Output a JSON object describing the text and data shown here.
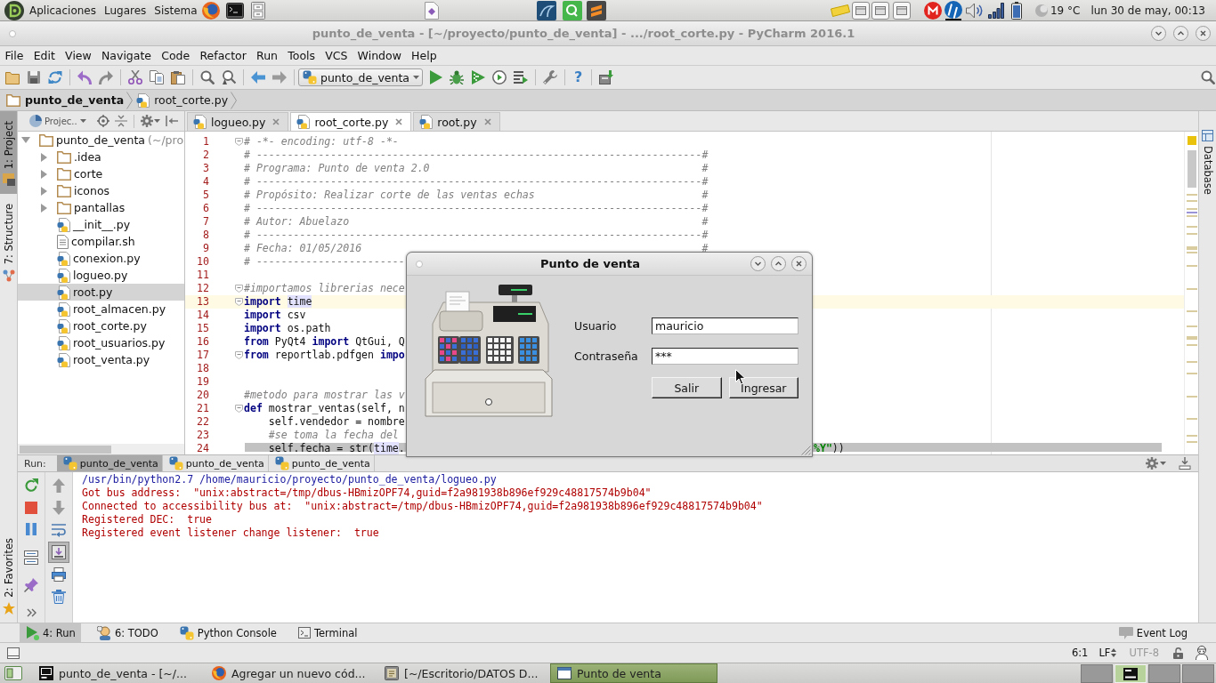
{
  "top_panel": {
    "menus": [
      "Aplicaciones",
      "Lugares",
      "Sistema"
    ],
    "temperature": "19 °C",
    "clock": "lun 30 de may, 00:13"
  },
  "window": {
    "title": "punto_de_venta - [~/proyecto/punto_de_venta] - .../root_corte.py - PyCharm 2016.1"
  },
  "menu_bar": [
    "File",
    "Edit",
    "View",
    "Navigate",
    "Code",
    "Refactor",
    "Run",
    "Tools",
    "VCS",
    "Window",
    "Help"
  ],
  "toolbar": {
    "run_configuration": "punto_de_venta",
    "help": "?"
  },
  "navigation_bar": [
    {
      "kind": "folder",
      "label": "punto_de_venta"
    },
    {
      "kind": "python",
      "label": "root_corte.py"
    }
  ],
  "left_tool_tabs": {
    "top": [
      {
        "kind": "project",
        "label": "1: Project",
        "selected": true
      },
      {
        "kind": "structure",
        "label": "7: Structure",
        "selected": false
      }
    ],
    "bottom": [
      {
        "kind": "favorites",
        "label": "2: Favorites",
        "selected": false
      }
    ]
  },
  "right_tool_tabs": [
    {
      "label": "Database",
      "selected": false
    }
  ],
  "project": {
    "view": "Projec..",
    "tree": [
      {
        "kind": "folder",
        "label": "punto_de_venta",
        "path": "(~/pro",
        "expanded": true,
        "selected": false,
        "children": [
          {
            "kind": "folder",
            "label": ".idea",
            "expanded": false,
            "selected": false
          },
          {
            "kind": "folder",
            "label": "corte",
            "expanded": false,
            "selected": false
          },
          {
            "kind": "folder",
            "label": "iconos",
            "expanded": false,
            "selected": false
          },
          {
            "kind": "folder",
            "label": "pantallas",
            "expanded": false,
            "selected": false
          },
          {
            "kind": "python",
            "label": "__init__.py",
            "selected": false
          },
          {
            "kind": "text",
            "label": "compilar.sh",
            "selected": false
          },
          {
            "kind": "python",
            "label": "conexion.py",
            "selected": false
          },
          {
            "kind": "python",
            "label": "logueo.py",
            "selected": false
          },
          {
            "kind": "python",
            "label": "root.py",
            "selected": true
          },
          {
            "kind": "python",
            "label": "root_almacen.py",
            "selected": false
          },
          {
            "kind": "python",
            "label": "root_corte.py",
            "selected": false
          },
          {
            "kind": "python",
            "label": "root_usuarios.py",
            "selected": false
          },
          {
            "kind": "python",
            "label": "root_venta.py",
            "selected": false
          }
        ]
      }
    ]
  },
  "editor": {
    "tabs": [
      {
        "label": "logueo.py",
        "selected": false
      },
      {
        "label": "root_corte.py",
        "selected": true
      },
      {
        "label": "root.py",
        "selected": false
      }
    ],
    "lines": [
      {
        "number": "1",
        "fold": true,
        "current": false,
        "parts": [
          {
            "kind": "comment",
            "text": "# -*- encoding: utf-8 -*-"
          }
        ]
      },
      {
        "number": "2",
        "fold": false,
        "current": false,
        "parts": [
          {
            "kind": "comment",
            "text": "# ------------------------------------------------------------------------#"
          }
        ]
      },
      {
        "number": "3",
        "fold": false,
        "current": false,
        "parts": [
          {
            "kind": "comment",
            "text": "# Programa: Punto de venta 2.0                                            #"
          }
        ]
      },
      {
        "number": "4",
        "fold": false,
        "current": false,
        "parts": [
          {
            "kind": "comment",
            "text": "# ------------------------------------------------------------------------#"
          }
        ]
      },
      {
        "number": "5",
        "fold": false,
        "current": false,
        "parts": [
          {
            "kind": "comment",
            "text": "# Propósito: Realizar corte de las ventas echas                           #"
          }
        ]
      },
      {
        "number": "6",
        "fold": false,
        "current": false,
        "parts": [
          {
            "kind": "comment",
            "text": "# ------------------------------------------------------------------------#"
          }
        ]
      },
      {
        "number": "7",
        "fold": false,
        "current": false,
        "parts": [
          {
            "kind": "comment",
            "text": "# Autor: Abuelazo                                                         #"
          }
        ]
      },
      {
        "number": "8",
        "fold": false,
        "current": false,
        "parts": [
          {
            "kind": "comment",
            "text": "# ------------------------------------------------------------------------#"
          }
        ]
      },
      {
        "number": "9",
        "fold": false,
        "current": false,
        "parts": [
          {
            "kind": "comment",
            "text": "# Fecha: 01/05/2016                                                       #"
          }
        ]
      },
      {
        "number": "10",
        "fold": false,
        "current": false,
        "parts": [
          {
            "kind": "comment",
            "text": "# ------------------------"
          }
        ]
      },
      {
        "number": "11",
        "fold": false,
        "current": false
      },
      {
        "number": "12",
        "fold": true,
        "current": false,
        "parts": [
          {
            "kind": "comment",
            "text": "#importamos librerias nece"
          }
        ]
      },
      {
        "number": "13",
        "fold": true,
        "current": true,
        "parts": [
          {
            "kind": "keyword",
            "text": "import "
          },
          {
            "kind": "usage",
            "text": "time"
          }
        ]
      },
      {
        "number": "14",
        "fold": false,
        "current": false,
        "parts": [
          {
            "kind": "keyword",
            "text": "import"
          },
          {
            "kind": "plain",
            "text": " csv"
          }
        ]
      },
      {
        "number": "15",
        "fold": false,
        "current": false,
        "parts": [
          {
            "kind": "keyword",
            "text": "import"
          },
          {
            "kind": "plain",
            "text": " os.path"
          }
        ]
      },
      {
        "number": "16",
        "fold": false,
        "current": false,
        "parts": [
          {
            "kind": "keyword",
            "text": "from"
          },
          {
            "kind": "plain",
            "text": " PyQt4 "
          },
          {
            "kind": "keyword",
            "text": "import"
          },
          {
            "kind": "plain",
            "text": " QtGui, Q"
          }
        ]
      },
      {
        "number": "17",
        "fold": true,
        "current": false,
        "parts": [
          {
            "kind": "keyword",
            "text": "from"
          },
          {
            "kind": "plain",
            "text": " reportlab.pdfgen "
          },
          {
            "kind": "keyword",
            "text": "impo"
          }
        ]
      },
      {
        "number": "18",
        "fold": false,
        "current": false
      },
      {
        "number": "19",
        "fold": false,
        "current": false
      },
      {
        "number": "20",
        "fold": false,
        "current": false,
        "parts": [
          {
            "kind": "comment",
            "text": "#metodo para mostrar las v"
          }
        ]
      },
      {
        "number": "21",
        "fold": true,
        "current": false,
        "parts": [
          {
            "kind": "keyword",
            "text": "def"
          },
          {
            "kind": "plain",
            "text": " mostrar_ventas(self, n"
          }
        ]
      },
      {
        "number": "22",
        "fold": false,
        "current": false,
        "parts": [
          {
            "kind": "plain",
            "text": "    self.vendedor = nombre"
          }
        ]
      },
      {
        "number": "23",
        "fold": false,
        "current": false,
        "parts": [
          {
            "kind": "comment",
            "text": "    #se toma la fecha del"
          }
        ]
      },
      {
        "number": "24",
        "fold": false,
        "current": false,
        "parts": [
          {
            "kind": "plain",
            "text": "    self.fecha = str("
          },
          {
            "kind": "usage",
            "text": "time"
          },
          {
            "kind": "plain",
            "text": "."
          }
        ],
        "tail": [
          {
            "kind": "string",
            "text": "%Y\""
          },
          {
            "kind": "plain",
            "text": "))"
          }
        ]
      }
    ]
  },
  "dialog": {
    "title": "Punto de venta",
    "fields": [
      {
        "label": "Usuario",
        "value": "mauricio"
      },
      {
        "label": "Contraseña",
        "value": "***"
      }
    ],
    "buttons": [
      "Salir",
      "Ingresar"
    ]
  },
  "run": {
    "label": "Run:",
    "tabs": [
      {
        "label": "punto_de_venta",
        "selected": true
      },
      {
        "label": "punto_de_venta",
        "selected": false
      },
      {
        "label": "punto_de_venta",
        "selected": false
      }
    ],
    "scroll_to_end": {
      "on": true
    },
    "console": [
      {
        "kind": "command",
        "text": "/usr/bin/python2.7 /home/mauricio/proyecto/punto_de_venta/logueo.py"
      },
      {
        "kind": "error",
        "text": "Got bus address:  \"unix:abstract=/tmp/dbus-HBmizOPF74,guid=f2a981938b896ef929c48817574b9b04\""
      },
      {
        "kind": "error",
        "text": "Connected to accessibility bus at:  \"unix:abstract=/tmp/dbus-HBmizOPF74,guid=f2a981938b896ef929c48817574b9b04\""
      },
      {
        "kind": "error",
        "text": "Registered DEC:  true"
      },
      {
        "kind": "error",
        "text": "Registered event listener change listener:  true"
      }
    ]
  },
  "tool_window_bar": {
    "tabs": [
      {
        "kind": "run",
        "label": "4: Run",
        "selected": true
      },
      {
        "kind": "todo",
        "label": "6: TODO",
        "selected": false
      },
      {
        "kind": "console",
        "label": "Python Console",
        "selected": false
      },
      {
        "kind": "terminal",
        "label": "Terminal",
        "selected": false
      }
    ],
    "event_log": "Event Log"
  },
  "status_bar": {
    "position": "6:1",
    "line_separator": "LF",
    "encoding": "UTF-8"
  },
  "taskbar": {
    "tasks": [
      {
        "kind": "ide",
        "label": "punto_de_venta - [~/...",
        "selected": false
      },
      {
        "kind": "browser",
        "label": "Agregar un nuevo cód...",
        "selected": false
      },
      {
        "kind": "editor",
        "label": "[~/Escritorio/DATOS D...",
        "selected": false
      },
      {
        "kind": "window",
        "label": "Punto de venta",
        "selected": true
      }
    ],
    "workspaces": [
      {
        "selected": false
      },
      {
        "selected": true
      },
      {
        "selected": false
      },
      {
        "selected": false
      }
    ]
  }
}
